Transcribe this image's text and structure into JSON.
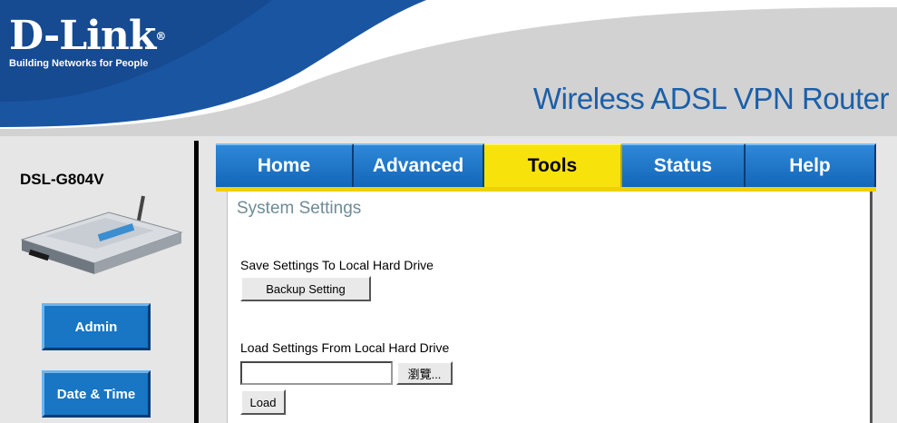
{
  "header": {
    "brand": "D-Link",
    "registered_mark": "®",
    "tagline": "Building Networks for People",
    "product_title": "Wireless ADSL VPN Router"
  },
  "sidebar": {
    "model": "DSL-G804V",
    "buttons": [
      "Admin",
      "Date & Time"
    ]
  },
  "tabs": [
    {
      "label": "Home",
      "active": false
    },
    {
      "label": "Advanced",
      "active": false
    },
    {
      "label": "Tools",
      "active": true
    },
    {
      "label": "Status",
      "active": false
    },
    {
      "label": "Help",
      "active": false
    }
  ],
  "main": {
    "section_title": "System Settings",
    "save_label": "Save Settings To Local Hard Drive",
    "backup_button": "Backup Setting",
    "load_label": "Load Settings From Local Hard Drive",
    "file_input_value": "",
    "browse_button": "瀏覽...",
    "load_button": "Load"
  },
  "colors": {
    "brand_blue": "#1b5fa8",
    "tab_blue": "#1876c4",
    "active_tab_yellow": "#f8e20c",
    "section_title_gray": "#6d8b97"
  }
}
